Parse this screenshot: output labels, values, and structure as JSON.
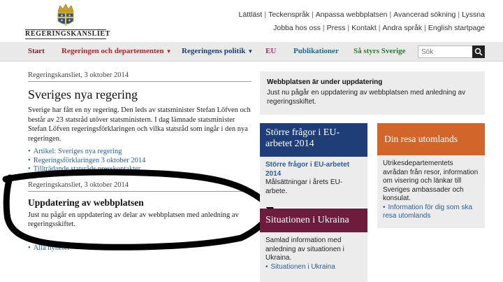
{
  "header": {
    "logo_text": "REGERINGSKANSLIET",
    "toplinks_row1": [
      "Lättläst",
      "Teckenspråk",
      "Anpassa webbplatsen",
      "Avancerad sökning",
      "Lyssna"
    ],
    "toplinks_row2": [
      "Jobba hos oss",
      "Press",
      "Kontakt",
      "Andra språk",
      "English startpage"
    ]
  },
  "nav": {
    "items": [
      {
        "label": "Start",
        "color": "#8b1a2b"
      },
      {
        "label": "Regeringen och departementen",
        "color": "#b3272d"
      },
      {
        "label": "Regeringens politik",
        "color": "#1f3e78"
      },
      {
        "label": "EU",
        "color": "#c0286a"
      },
      {
        "label": "Publikationer",
        "color": "#1a6b8a"
      },
      {
        "label": "Så styrs Sverige",
        "color": "#2f7a34"
      }
    ],
    "search_placeholder": "Sök"
  },
  "main": {
    "news1": {
      "meta": "Regeringskansliet, 3 oktober 2014",
      "title": "Sveriges nya regering",
      "text": "Sverige har fått en ny regering. Den leds av statsminister Stefan Löfven och består av 23 statsråd utöver statsministern. I dag lämnade statsminister Stefan Löfven regeringsförklaringen och vilka statsråd som ingår i den nya regeringen.",
      "links": [
        "Artikel: Sveriges nya regering",
        "Regeringsförklaringen 3 oktober 2014",
        "Tillträdande statsråds presskontakter"
      ]
    },
    "news2": {
      "meta": "Regeringskansliet, 3 oktober 2014",
      "title": "Uppdatering av webbplatsen",
      "text": "Just nu pågår en uppdatering av delar av webbplatsen med anledning av regeringsskiftet."
    },
    "all_news": "Alla nyheter"
  },
  "right": {
    "notice": {
      "title": "Webbplatsen är under uppdatering",
      "text": "Just nu pågår en uppdatering av webbplatsen med anledning av regeringsskiftet."
    },
    "eu_card": {
      "banner": "Större frågor i EU-arbetet 2014",
      "link": "Större frågor i EU-arbetet 2014",
      "text": "Målsättningar i årets EU-arbete."
    },
    "resa_card": {
      "banner": "Din resa utomlands",
      "text": "Utrikesdepartementets avrådan från resor, information om visering och länkar till Sveriges ambassader och konsulat.",
      "link": "Information för dig som ska resa utomlands"
    },
    "ukraina_card": {
      "banner": "Situationen i Ukraina",
      "text": "Samlad information med anledning av situationen i Ukraina.",
      "link": "Situationen i Ukraina"
    }
  }
}
